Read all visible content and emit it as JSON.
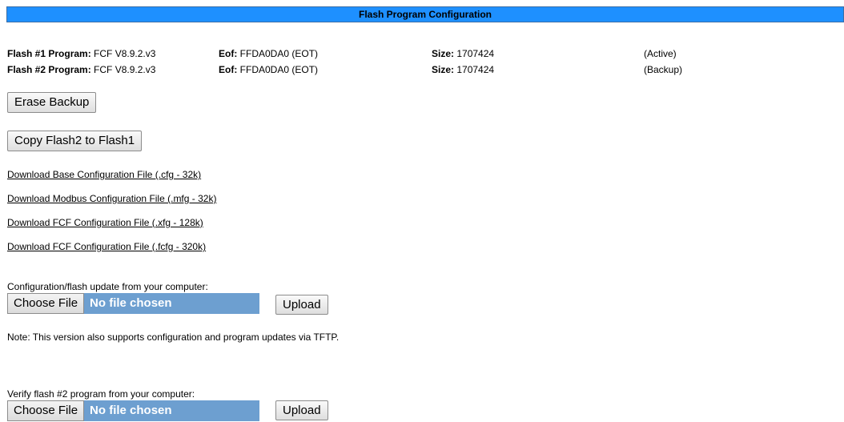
{
  "header": {
    "title": "Flash Program Configuration"
  },
  "flash": [
    {
      "program_label": "Flash #1 Program:",
      "program": "FCF V8.9.2.v3",
      "eof_label": "Eof:",
      "eof": "FFDA0DA0 (EOT)",
      "size_label": "Size:",
      "size": "1707424",
      "status": "(Active)"
    },
    {
      "program_label": "Flash #2 Program:",
      "program": "FCF V8.9.2.v3",
      "eof_label": "Eof:",
      "eof": "FFDA0DA0 (EOT)",
      "size_label": "Size:",
      "size": "1707424",
      "status": "(Backup)"
    }
  ],
  "buttons": {
    "erase_backup": "Erase Backup",
    "copy_flash": "Copy Flash2 to Flash1"
  },
  "downloads": [
    "Download Base Configuration File (.cfg - 32k)",
    "Download Modbus Configuration File (.mfg - 32k)",
    "Download FCF Configuration File (.xfg - 128k)",
    "Download FCF Configuration File (.fcfg - 320k)"
  ],
  "update": {
    "label": "Configuration/flash update from your computer:",
    "choose_label": "Choose File",
    "file_status": "No file chosen",
    "upload_label": "Upload"
  },
  "note": "Note: This version also supports configuration and program updates via TFTP.",
  "verify": {
    "label": "Verify flash #2 program from your computer:",
    "choose_label": "Choose File",
    "file_status": "No file chosen",
    "upload_label": "Upload"
  }
}
